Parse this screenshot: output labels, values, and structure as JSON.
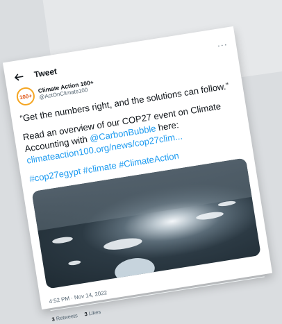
{
  "header": {
    "title": "Tweet"
  },
  "author": {
    "avatar_text": "100+",
    "display_name": "Climate Action 100+",
    "handle": "@ActOnClimate100"
  },
  "tweet": {
    "quote": "“Get the numbers right, and the solutions can follow.”",
    "line2_prefix": "Read an overview of our COP27 event on Climate Accounting with ",
    "mention": "@CarbonBubble",
    "line2_suffix": " here:",
    "link": "climateaction100.org/news/cop27clim...",
    "hashtags": "#cop27egypt #climate #ClimateAction"
  },
  "meta": {
    "timestamp": "4:52 PM · Nov 14, 2022",
    "retweets_count": "3",
    "retweets_label": "Retweets",
    "likes_count": "3",
    "likes_label": "Likes"
  },
  "colors": {
    "link": "#1d9bf0",
    "avatar_ring": "#f5a623"
  },
  "icons": {
    "back": "arrow-left-icon",
    "more": "more-icon"
  }
}
